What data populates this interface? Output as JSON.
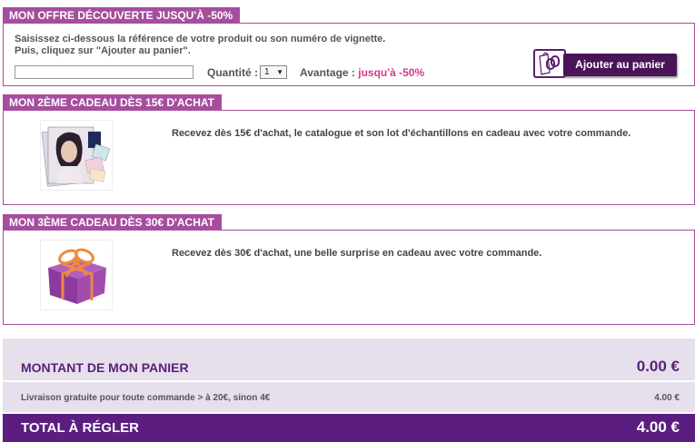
{
  "offer": {
    "title": "MON OFFRE DÉCOUVERTE JUSQU'À -50%",
    "instruction_line1": "Saisissez ci-dessous la référence de votre produit ou son numéro de vignette.",
    "instruction_line2": "Puis, cliquez sur \"Ajouter au panier\".",
    "reference_value": "",
    "quantity_label": "Quantité :",
    "quantity_value": "1",
    "advantage_label": "Avantage :",
    "advantage_value": "jusqu'à -50%",
    "add_to_cart_label": "Ajouter au panier"
  },
  "gift2": {
    "title": "MON 2ÈME CADEAU DÈS 15€ D'ACHAT",
    "text": "Recevez dès 15€ d'achat, le catalogue et son lot d'échantillons en cadeau avec votre commande."
  },
  "gift3": {
    "title": "MON 3ÈME CADEAU DÈS 30€ D'ACHAT",
    "text": "Recevez dès 30€ d'achat, une belle surprise en cadeau avec votre commande."
  },
  "totals": {
    "cart_amount_label": "MONTANT DE MON PANIER",
    "cart_amount_value": "0.00 €",
    "shipping_label": "Livraison gratuite pour toute commande > à 20€, sinon 4€",
    "shipping_value": "4.00 €",
    "total_label": "TOTAL À RÉGLER",
    "total_value": "4.00 €"
  },
  "colors": {
    "section_accent": "#a64d9e",
    "advantage": "#d63a8a",
    "total_bar": "#5b1e80",
    "summary_bg": "#e5e0eb"
  },
  "icons": {
    "cart_button_icon": "shopping-bag-link-icon",
    "select_arrow": "triangle-down-icon"
  }
}
